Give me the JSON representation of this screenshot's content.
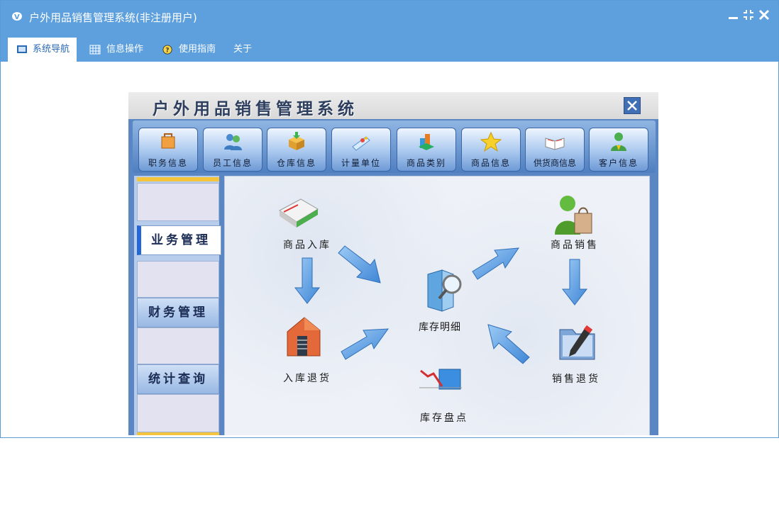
{
  "window": {
    "title": "户外用品销售管理系统(非注册用户)"
  },
  "tabs": [
    {
      "label": "系统导航",
      "icon": "monitor-icon"
    },
    {
      "label": "信息操作",
      "icon": "grid-icon"
    },
    {
      "label": "使用指南",
      "icon": "help-icon"
    },
    {
      "label": "关于",
      "icon": ""
    }
  ],
  "panel": {
    "title": "户外用品销售管理系统",
    "toolbar": [
      {
        "label": "职务信息",
        "icon": "briefcase-icon"
      },
      {
        "label": "员工信息",
        "icon": "users-icon"
      },
      {
        "label": "仓库信息",
        "icon": "box-icon"
      },
      {
        "label": "计量单位",
        "icon": "ruler-icon"
      },
      {
        "label": "商品类别",
        "icon": "category-icon"
      },
      {
        "label": "商品信息",
        "icon": "star-icon"
      },
      {
        "label": "供货商信息",
        "icon": "book-icon"
      },
      {
        "label": "客户信息",
        "icon": "customer-icon"
      }
    ],
    "sidebar": {
      "items": [
        {
          "label": "业务管理",
          "active": true
        },
        {
          "label": "财务管理",
          "active": false
        },
        {
          "label": "统计查询",
          "active": false
        }
      ]
    },
    "flow": {
      "goods_in": "商品入库",
      "in_return": "入库退货",
      "stock_detail": "库存明细",
      "stock_check": "库存盘点",
      "goods_sale": "商品销售",
      "sale_return": "销售退货"
    }
  },
  "colors": {
    "titlebar": "#5da0dd",
    "accent": "#2266d8",
    "arrow": "#5b9fe0"
  }
}
